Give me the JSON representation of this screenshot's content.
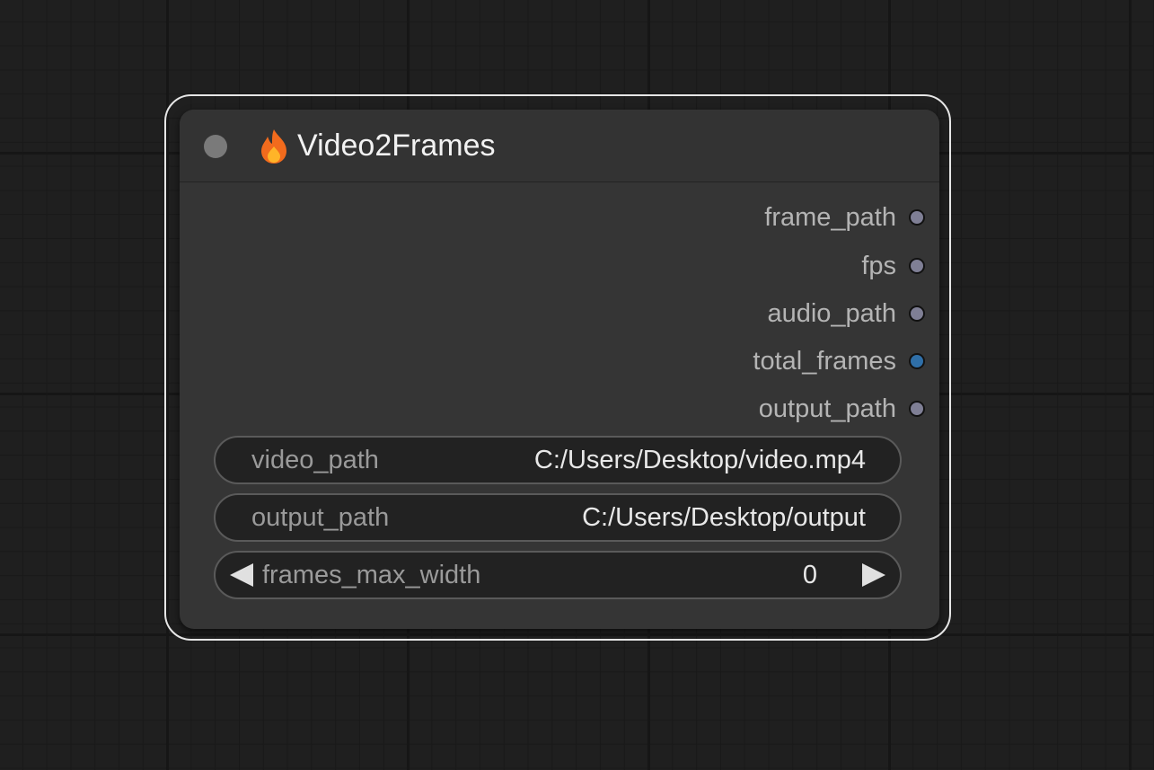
{
  "node": {
    "title": "Video2Frames",
    "icon": "flame-icon",
    "outputs": [
      {
        "label": "frame_path",
        "color": "#7f7f95"
      },
      {
        "label": "fps",
        "color": "#7f7f95"
      },
      {
        "label": "audio_path",
        "color": "#7f7f95"
      },
      {
        "label": "total_frames",
        "color": "#2f6fa8"
      },
      {
        "label": "output_path",
        "color": "#7f7f95"
      }
    ],
    "widgets": {
      "video_path": {
        "label": "video_path",
        "value": "C:/Users/Desktop/video.mp4"
      },
      "output_path": {
        "label": "output_path",
        "value": "C:/Users/Desktop/output"
      },
      "frames_max_width": {
        "label": "frames_max_width",
        "value": "0"
      }
    }
  },
  "colors": {
    "canvas": "#1f1f1f",
    "node_body": "#353535",
    "selection_outline": "#e6e6e6",
    "flame_outer": "#f26b1d",
    "flame_inner": "#ffb428"
  }
}
